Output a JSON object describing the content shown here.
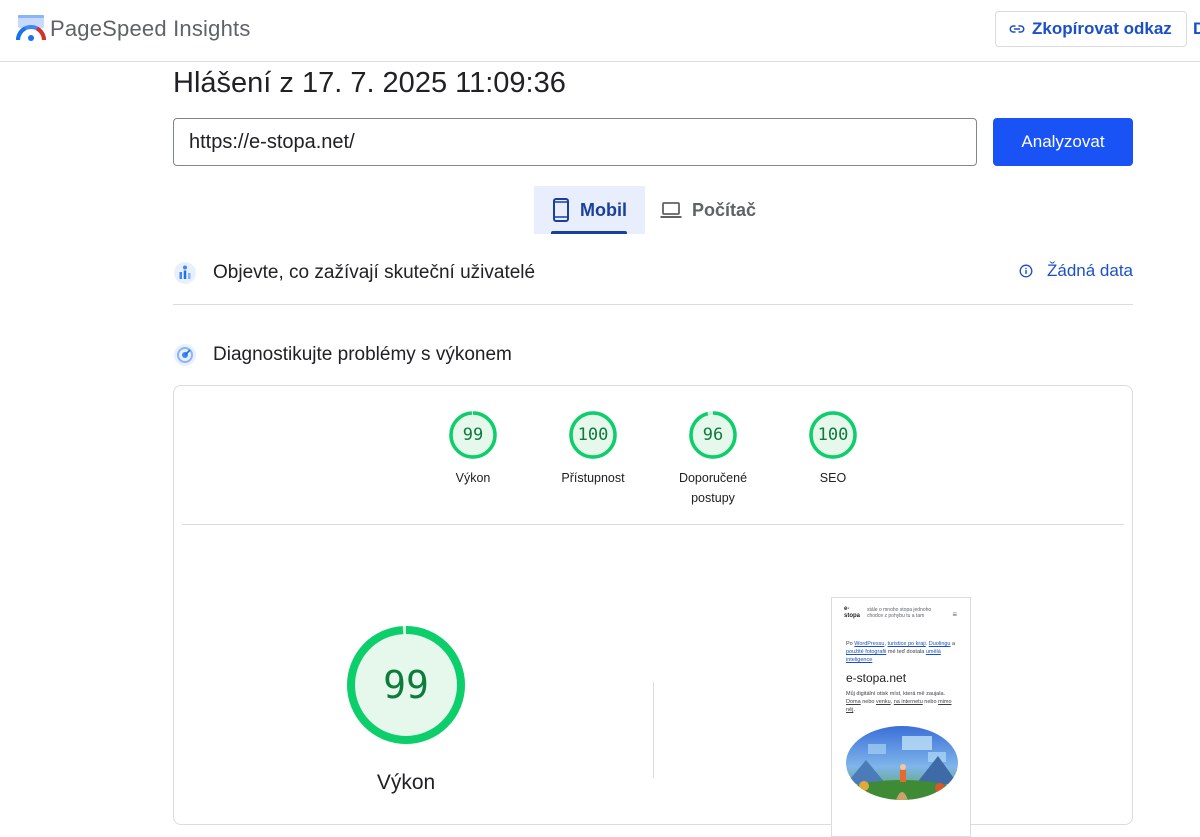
{
  "header": {
    "app_title": "PageSpeed Insights",
    "copy_link_label": "Zkopírovat odkaz",
    "edge_cut_label": "D"
  },
  "report": {
    "title": "Hlášení z 17. 7. 2025 11:09:36",
    "url_value": "https://e-stopa.net/",
    "analyze_label": "Analyzovat"
  },
  "device_tabs": [
    {
      "label": "Mobil",
      "selected": true,
      "icon": "smartphone-icon"
    },
    {
      "label": "Počítač",
      "selected": false,
      "icon": "laptop-icon"
    }
  ],
  "field_data": {
    "title": "Objevte, co zažívají skuteční uživatelé",
    "no_data_label": "Žádná data"
  },
  "lab_data": {
    "title": "Diagnostikujte problémy s výkonem"
  },
  "scores": [
    {
      "value": "99",
      "label": "Výkon"
    },
    {
      "value": "100",
      "label": "Přístupnost"
    },
    {
      "value": "96",
      "label": "Doporučené postupy"
    },
    {
      "value": "100",
      "label": "SEO"
    }
  ],
  "main_score": {
    "value": "99",
    "label": "Výkon"
  },
  "screenshot": {
    "brand_line1": "e-",
    "brand_line2": "stopa",
    "tagline": "stále o mnoho stopa jednoho chodce z pohybu tu a tam",
    "menu_glyph": "≡",
    "intro_pre": "Po ",
    "intro_link1": "WordPressu",
    "intro_mid1": ", ",
    "intro_link2": "turistice po kraji",
    "intro_mid2": ". ",
    "intro_link3": "Duolingu",
    "intro_mid3": " a ",
    "intro_link4": "použité fotografii",
    "intro_mid4": " mé teď dostala ",
    "intro_link5": "umělá inteligence",
    "site_title": "e-stopa.net",
    "desc_pre": "Můj digitální otisk míst, která mě zaujala. ",
    "desc_link1": "Doma",
    "desc_mid1": " nebo ",
    "desc_link2": "venku",
    "desc_mid2": ", ",
    "desc_link3": "na internetu",
    "desc_mid3": " nebo ",
    "desc_link4": "mimo něj",
    "desc_end": "."
  },
  "colors": {
    "accent": "#1a53f5",
    "link": "#1a4fc9",
    "score_good": "#0cce6b",
    "score_good_bg": "#e6f7ec",
    "score_text": "#0c7c3a"
  }
}
